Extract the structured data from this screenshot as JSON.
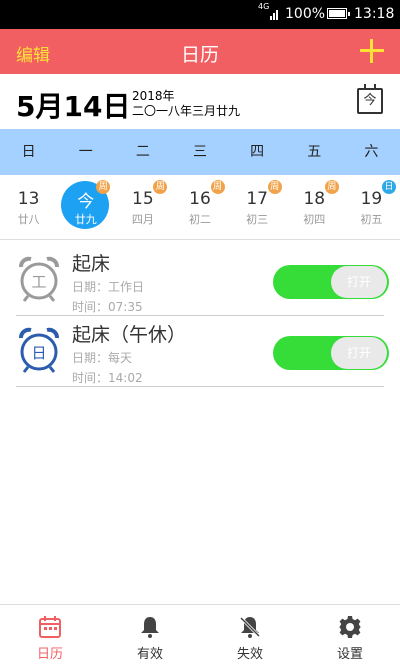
{
  "status_bar": {
    "network": "4G",
    "battery": "100%",
    "time": "13:18"
  },
  "app_bar": {
    "edit_label": "编辑",
    "title": "日历",
    "add_icon": "plus-icon"
  },
  "date_header": {
    "date": "5月14日",
    "year": "2018年",
    "lunar": "二〇一八年三月廿九",
    "today_button": "今"
  },
  "weekdays": [
    "日",
    "一",
    "二",
    "三",
    "四",
    "五",
    "六"
  ],
  "days": [
    {
      "num": "13",
      "lunar": "廿八",
      "badge": ""
    },
    {
      "num": "今",
      "lunar": "廿九",
      "badge": "周",
      "selected": true
    },
    {
      "num": "15",
      "lunar": "四月",
      "badge": "周"
    },
    {
      "num": "16",
      "lunar": "初二",
      "badge": "周"
    },
    {
      "num": "17",
      "lunar": "初三",
      "badge": "周"
    },
    {
      "num": "18",
      "lunar": "初四",
      "badge": "周"
    },
    {
      "num": "19",
      "lunar": "初五",
      "badge": "日"
    }
  ],
  "alarms": [
    {
      "icon_label": "工",
      "name": "起床",
      "date_line": "日期：工作日",
      "time_line": "时间：07:35",
      "toggle_label": "打开",
      "icon_color": "#9a9a9a"
    },
    {
      "icon_label": "日",
      "name": "起床（午休）",
      "date_line": "日期：每天",
      "time_line": "时间：14:02",
      "toggle_label": "打开",
      "icon_color": "#2b5cad"
    }
  ],
  "tabs": [
    {
      "label": "日历",
      "icon": "calendar-icon",
      "active": true
    },
    {
      "label": "有效",
      "icon": "bell-icon"
    },
    {
      "label": "失效",
      "icon": "bell-off-icon"
    },
    {
      "label": "设置",
      "icon": "gear-icon"
    }
  ],
  "colors": {
    "accent": "#f25f62",
    "yellow": "#ffe236",
    "week_bg": "#a4d1ff",
    "selected": "#1da1f2",
    "toggle_on": "#36dc38"
  }
}
